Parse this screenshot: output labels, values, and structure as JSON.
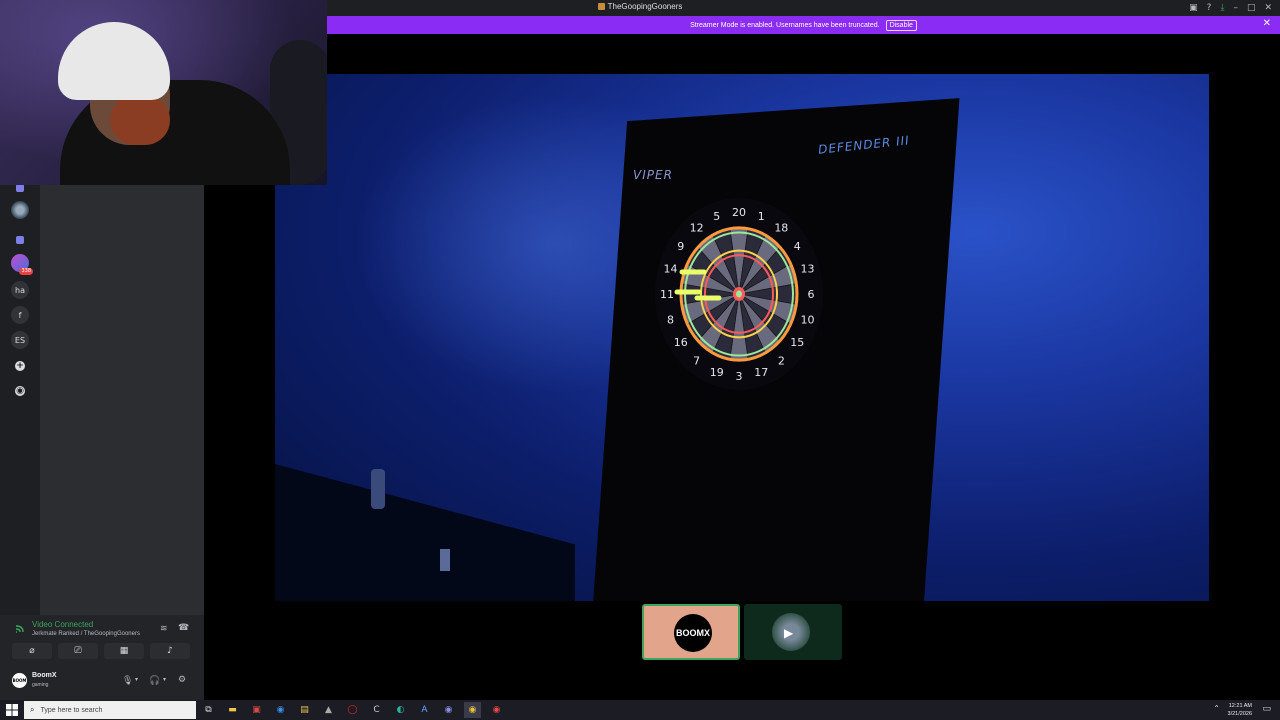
{
  "window": {
    "title": "TheGoopingGooners"
  },
  "banner": {
    "message": "Streamer Mode is enabled. Usernames have been truncated.",
    "button_label": "Disable"
  },
  "rail": {
    "items": [
      {
        "label": "ha"
      },
      {
        "label": "f"
      },
      {
        "label": "ES"
      }
    ],
    "badge_count": "338"
  },
  "voice": {
    "status": "Video Connected",
    "channel": "Jerkmate Ranked / TheGoopingGooners"
  },
  "user": {
    "name": "BoomX",
    "status": "gaming",
    "avatar_text": "BOOM"
  },
  "stream": {
    "board_brand": "VIPER",
    "board_model": "DEFENDER III",
    "dartboard_numbers": [
      "20",
      "1",
      "18",
      "4",
      "13",
      "6",
      "10",
      "15",
      "2",
      "17",
      "3",
      "19",
      "7",
      "16",
      "8",
      "11",
      "14",
      "9",
      "12",
      "5"
    ]
  },
  "tiles": {
    "active_label": "BOOMX"
  },
  "taskbar": {
    "search_placeholder": "Type here to search",
    "time": "12:21 AM",
    "date": "3/21/2026"
  },
  "colors": {
    "banner": "#8b2cf5",
    "connected": "#3ba55d",
    "tile_active": "#e2a48a"
  }
}
